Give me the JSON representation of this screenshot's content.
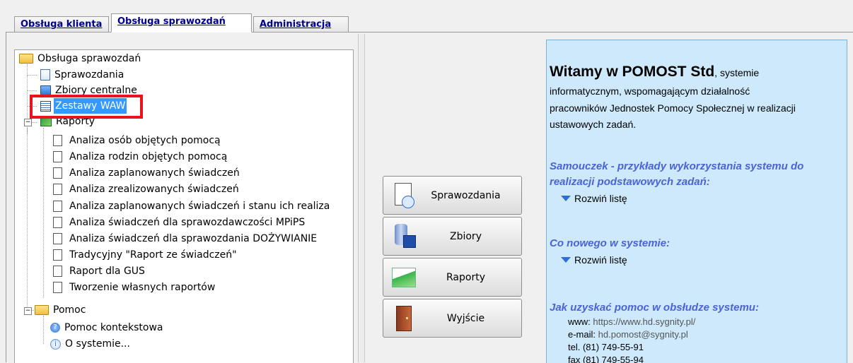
{
  "tabs": [
    {
      "label": "Obsługa klienta",
      "active": false
    },
    {
      "label": "Obsługa sprawozdań",
      "active": true
    },
    {
      "label": "Administracja",
      "active": false
    }
  ],
  "tree": {
    "root": "Obsługa sprawozdań",
    "items": [
      {
        "label": "Sprawozdania",
        "icon": "report-doc-icon"
      },
      {
        "label": "Zbiory centralne",
        "icon": "data-set-icon"
      },
      {
        "label": "Zestawy WAW",
        "icon": "table-icon",
        "selected": true
      }
    ],
    "raporty": {
      "label": "Raporty",
      "items": [
        "Analiza osób objętych pomocą",
        "Analiza rodzin objętych pomocą",
        "Analiza zaplanowanych świadczeń",
        "Analiza zrealizowanych świadczeń",
        "Analiza zaplanowanych świadczeń i stanu ich realiza",
        "Analiza świadczeń dla sprawozdawczości MPiPS",
        "Analiza świadczeń dla sprawozdania DOŻYWIANIE",
        "Tradycyjny  \"Raport ze świadczeń\"",
        "Raport dla GUS",
        "Tworzenie własnych raportów"
      ]
    },
    "pomoc": {
      "label": "Pomoc",
      "items": [
        "Pomoc kontekstowa",
        "O systemie..."
      ]
    }
  },
  "buttons": {
    "sprawozdania": "Sprawozdania",
    "zbiory": "Zbiory",
    "raporty": "Raporty",
    "wyjscie": "Wyjście"
  },
  "info": {
    "welcome_bold": "Witamy w POMOST Std",
    "welcome_rest": ", systemie",
    "welcome_line2": "informatycznym, wspomagającym działalność",
    "welcome_line3": "pracowników Jednostek Pomocy Społecznej w realizacji",
    "welcome_line4": "ustawowych zadań.",
    "samouczek_line1": "Samouczek - przykłady wykorzystania systemu do",
    "samouczek_line2": "realizacji podstawowych zadań:",
    "expand_label": "Rozwiń listę",
    "nowosci": "Co nowego w systemie:",
    "pomoc_hdr": "Jak uzyskać pomoc w obsłudze systemu:",
    "www_label": "www:",
    "www_value": "https://www.hd.sygnity.pl/",
    "email_label": "e-mail:",
    "email_value": "hd.pomost@sygnity.pl",
    "tel": "tel. (81) 749-55-91",
    "fax": "fax (81) 749-55-94"
  },
  "colors": {
    "accent": "#3399ff",
    "info_bg": "#cde9fb",
    "heading_blue": "#4b63d6",
    "highlight": "#e8141c"
  }
}
